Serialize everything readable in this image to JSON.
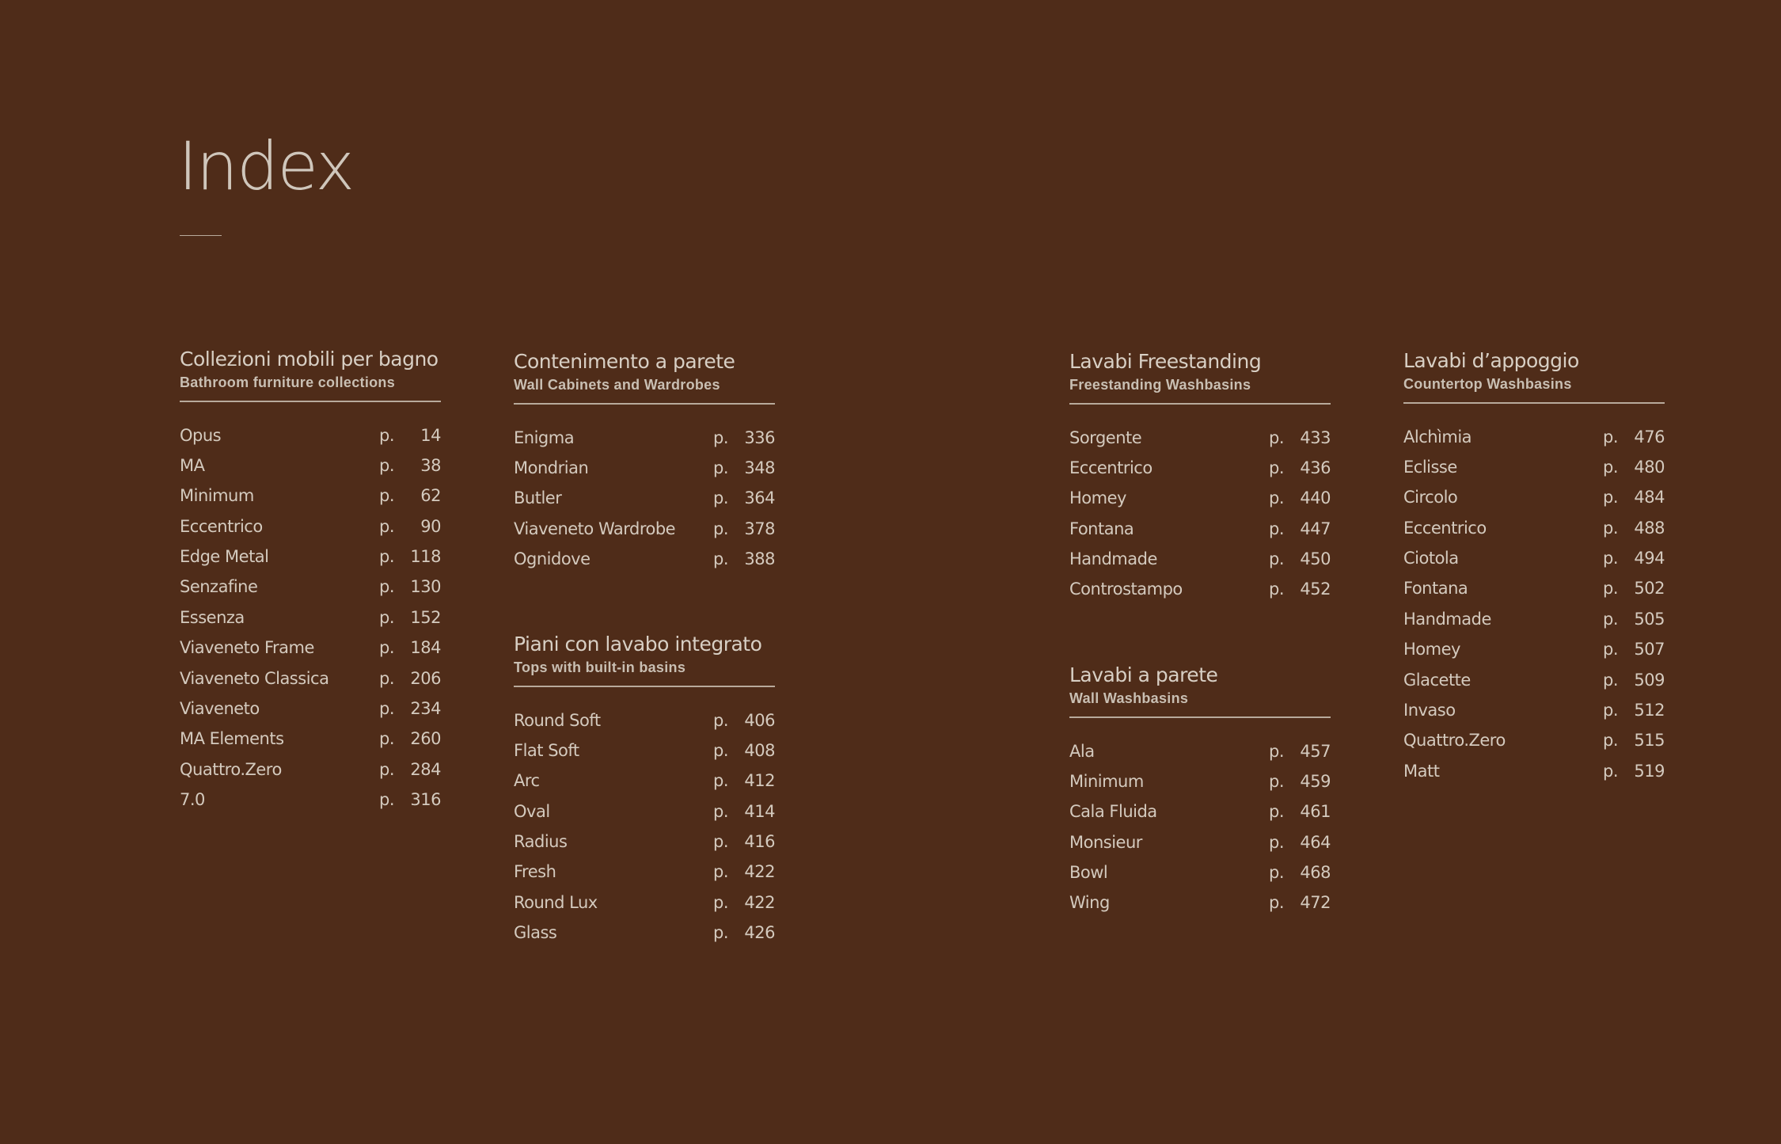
{
  "title": "Index",
  "sections": [
    {
      "id": "collezioni",
      "title": "Collezioni mobili per bagno",
      "subtitle": "Bathroom furniture collections",
      "entries": [
        {
          "name": "Opus",
          "prefix": "p.",
          "page": "14"
        },
        {
          "name": "MA",
          "prefix": "p.",
          "page": "38"
        },
        {
          "name": "Minimum",
          "prefix": "p.",
          "page": "62"
        },
        {
          "name": "Eccentrico",
          "prefix": "p.",
          "page": "90"
        },
        {
          "name": "Edge Metal",
          "prefix": "p.",
          "page": "118"
        },
        {
          "name": "Senzafine",
          "prefix": "p.",
          "page": "130"
        },
        {
          "name": "Essenza",
          "prefix": "p.",
          "page": "152"
        },
        {
          "name": "Viaveneto Frame",
          "prefix": "p.",
          "page": "184"
        },
        {
          "name": "Viaveneto Classica",
          "prefix": "p.",
          "page": "206"
        },
        {
          "name": "Viaveneto",
          "prefix": "p.",
          "page": "234"
        },
        {
          "name": "MA Elements",
          "prefix": "p.",
          "page": "260"
        },
        {
          "name": "Quattro.Zero",
          "prefix": "p.",
          "page": "284"
        },
        {
          "name": "7.0",
          "prefix": "p.",
          "page": "316"
        }
      ]
    },
    {
      "id": "contenimento",
      "title": "Contenimento a parete",
      "subtitle": "Wall Cabinets and Wardrobes",
      "entries": [
        {
          "name": "Enigma",
          "prefix": "p.",
          "page": "336"
        },
        {
          "name": "Mondrian",
          "prefix": "p.",
          "page": "348"
        },
        {
          "name": "Butler",
          "prefix": "p.",
          "page": "364"
        },
        {
          "name": "Viaveneto Wardrobe",
          "prefix": "p.",
          "page": "378"
        },
        {
          "name": "Ognidove",
          "prefix": "p.",
          "page": "388"
        }
      ]
    },
    {
      "id": "piani",
      "title": "Piani con lavabo integrato",
      "subtitle": "Tops with built-in basins",
      "entries": [
        {
          "name": "Round Soft",
          "prefix": "p.",
          "page": "406"
        },
        {
          "name": "Flat Soft",
          "prefix": "p.",
          "page": "408"
        },
        {
          "name": "Arc",
          "prefix": "p.",
          "page": "412"
        },
        {
          "name": "Oval",
          "prefix": "p.",
          "page": "414"
        },
        {
          "name": "Radius",
          "prefix": "p.",
          "page": "416"
        },
        {
          "name": "Fresh",
          "prefix": "p.",
          "page": "422"
        },
        {
          "name": "Round Lux",
          "prefix": "p.",
          "page": "422"
        },
        {
          "name": "Glass",
          "prefix": "p.",
          "page": "426"
        }
      ]
    },
    {
      "id": "freestanding",
      "title": "Lavabi Freestanding",
      "subtitle": "Freestanding Washbasins",
      "entries": [
        {
          "name": "Sorgente",
          "prefix": "p.",
          "page": "433"
        },
        {
          "name": "Eccentrico",
          "prefix": "p.",
          "page": "436"
        },
        {
          "name": "Homey",
          "prefix": "p.",
          "page": "440"
        },
        {
          "name": "Fontana",
          "prefix": "p.",
          "page": "447"
        },
        {
          "name": "Handmade",
          "prefix": "p.",
          "page": "450"
        },
        {
          "name": "Controstampo",
          "prefix": "p.",
          "page": "452"
        }
      ]
    },
    {
      "id": "parete",
      "title": "Lavabi a parete",
      "subtitle": "Wall Washbasins",
      "entries": [
        {
          "name": "Ala",
          "prefix": "p.",
          "page": "457"
        },
        {
          "name": "Minimum",
          "prefix": "p.",
          "page": "459"
        },
        {
          "name": "Cala Fluida",
          "prefix": "p.",
          "page": "461"
        },
        {
          "name": "Monsieur",
          "prefix": "p.",
          "page": "464"
        },
        {
          "name": "Bowl",
          "prefix": "p.",
          "page": "468"
        },
        {
          "name": "Wing",
          "prefix": "p.",
          "page": "472"
        }
      ]
    },
    {
      "id": "appoggio",
      "title": "Lavabi d’appoggio",
      "subtitle": "Countertop Washbasins",
      "entries": [
        {
          "name": "Alchìmia",
          "prefix": "p.",
          "page": "476"
        },
        {
          "name": "Eclisse",
          "prefix": "p.",
          "page": "480"
        },
        {
          "name": "Circolo",
          "prefix": "p.",
          "page": "484"
        },
        {
          "name": "Eccentrico",
          "prefix": "p.",
          "page": "488"
        },
        {
          "name": "Ciotola",
          "prefix": "p.",
          "page": "494"
        },
        {
          "name": "Fontana",
          "prefix": "p.",
          "page": "502"
        },
        {
          "name": "Handmade",
          "prefix": "p.",
          "page": "505"
        },
        {
          "name": "Homey",
          "prefix": "p.",
          "page": "507"
        },
        {
          "name": "Glacette",
          "prefix": "p.",
          "page": "509"
        },
        {
          "name": "Invaso",
          "prefix": "p.",
          "page": "512"
        },
        {
          "name": "Quattro.Zero",
          "prefix": "p.",
          "page": "515"
        },
        {
          "name": "Matt",
          "prefix": "p.",
          "page": "519"
        }
      ]
    }
  ]
}
